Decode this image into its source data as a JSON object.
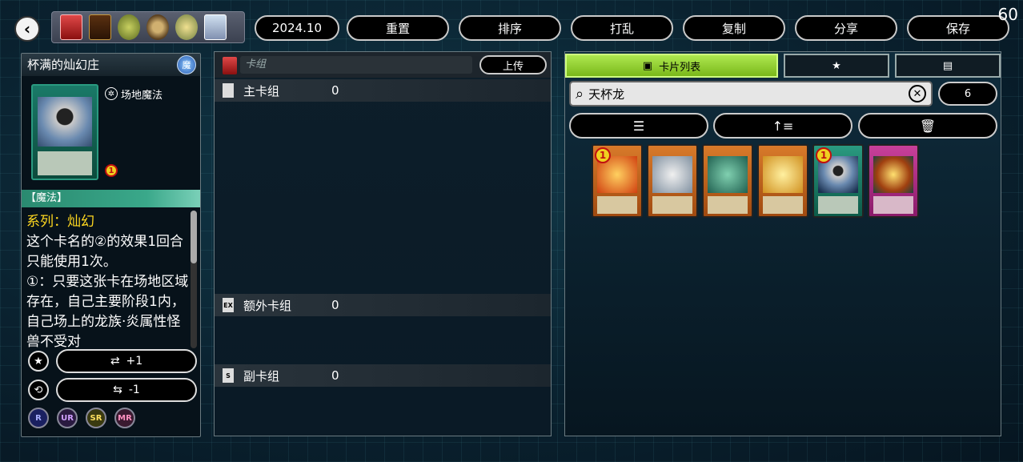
{
  "fps": "60",
  "toolbar": {
    "date_label": "2024.10",
    "reset_label": "重置",
    "sort_label": "排序",
    "shuffle_label": "打乱",
    "copy_label": "复制",
    "share_label": "分享",
    "save_label": "保存"
  },
  "card_detail": {
    "name": "杯满的灿幻庄",
    "attribute": "魔",
    "type_icon": "field-spell-icon",
    "type_text": "场地魔法",
    "limit": "1",
    "category": "【魔法】",
    "archetype": "系列：灿幻",
    "effect_1": "这个卡名的②的效果1回合只能使用1次。",
    "effect_2": "①：只要这张卡在场地区域存在，自己主要阶段1内，自己场上的龙族·炎属性怪兽不受对",
    "add_label": "+1",
    "remove_label": "-1",
    "rarities": [
      "R",
      "UR",
      "SR",
      "MR"
    ]
  },
  "deck": {
    "name_placeholder": "卡组",
    "upload_label": "上传",
    "sections": [
      {
        "icon": "",
        "label": "主卡组",
        "count": "0"
      },
      {
        "icon": "EX",
        "label": "额外卡组",
        "count": "0"
      },
      {
        "icon": "S",
        "label": "副卡组",
        "count": "0"
      }
    ]
  },
  "card_list": {
    "tabs": [
      {
        "label": "卡片列表",
        "icon": "briefcase-icon"
      },
      {
        "label": "",
        "icon": "star-icon"
      },
      {
        "label": "",
        "icon": "clipboard-icon"
      }
    ],
    "search_value": "天杯龙",
    "result_count": "6",
    "filter_icon": "sliders-icon",
    "sort_icon": "sort-icon",
    "delete_icon": "trash-icon",
    "cards": [
      {
        "frame": "orange",
        "limit": "1"
      },
      {
        "frame": "orange",
        "limit": ""
      },
      {
        "frame": "orange",
        "limit": ""
      },
      {
        "frame": "orange",
        "limit": ""
      },
      {
        "frame": "green",
        "limit": "1"
      },
      {
        "frame": "pink",
        "limit": ""
      }
    ]
  }
}
